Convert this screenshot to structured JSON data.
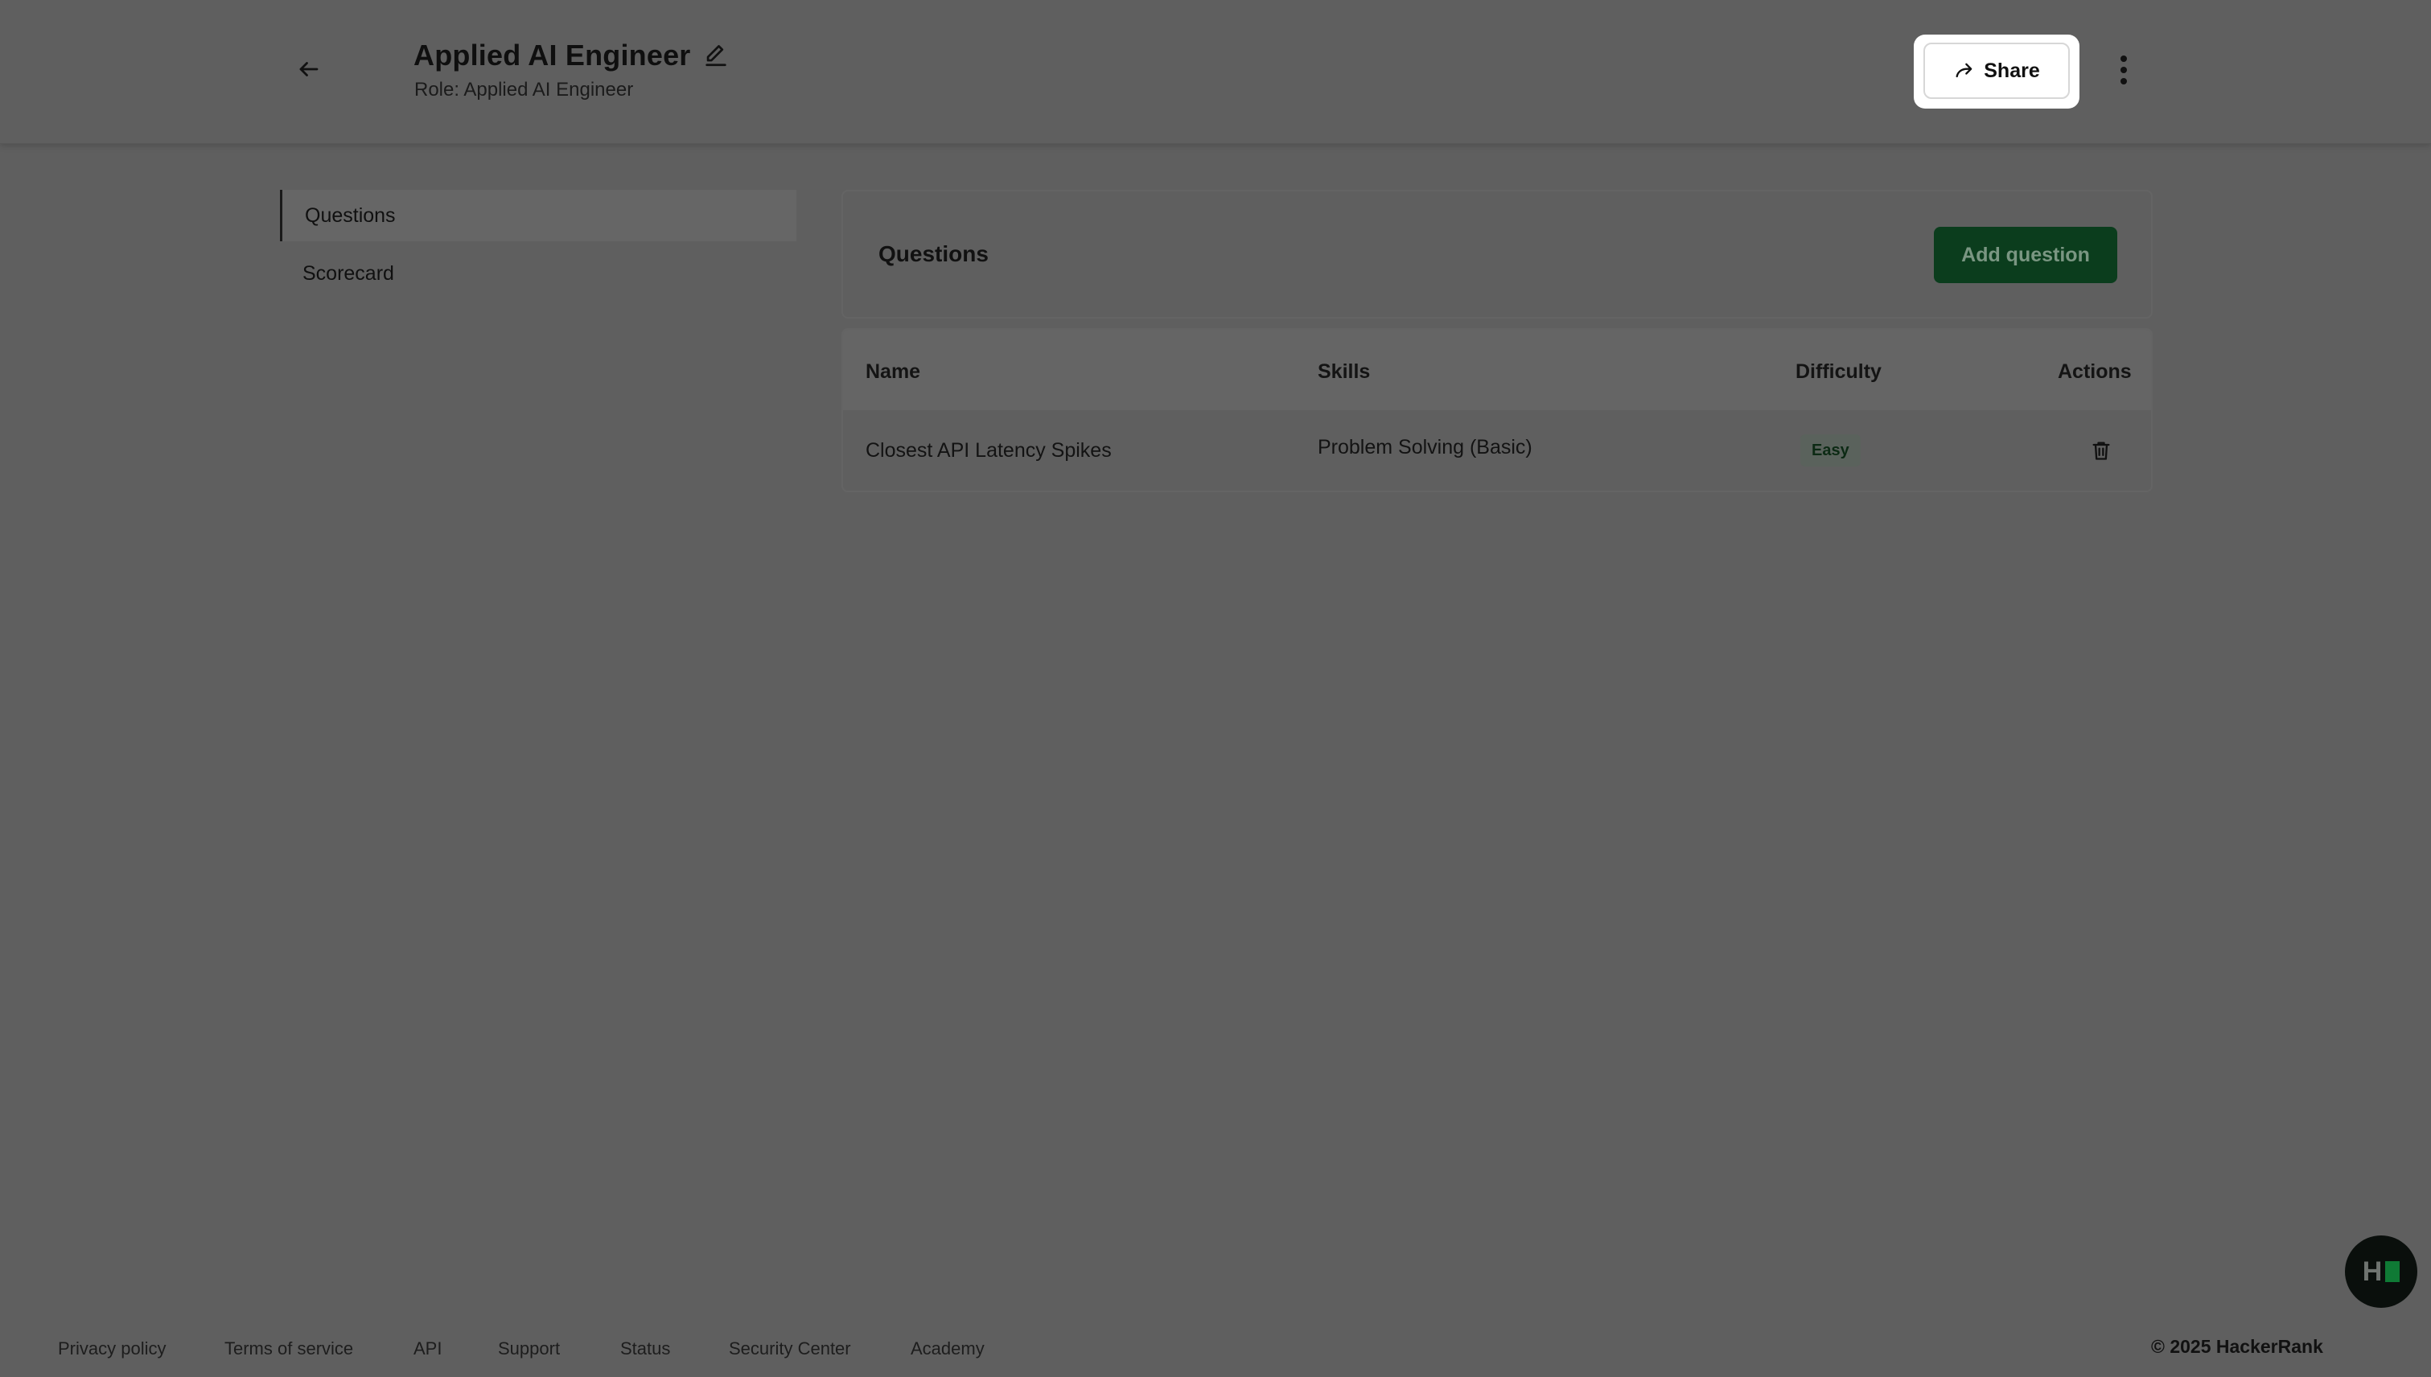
{
  "header": {
    "title": "Applied AI Engineer",
    "subtitle": "Role: Applied AI Engineer",
    "share_label": "Share",
    "icons": [
      "arrow-left-icon",
      "pencil-icon",
      "share-arrow-icon",
      "kebab-menu-icon"
    ]
  },
  "sidebar": {
    "items": [
      {
        "label": "Questions",
        "active": true
      },
      {
        "label": "Scorecard",
        "active": false
      }
    ]
  },
  "questions": {
    "title": "Questions",
    "add_label": "Add question",
    "add_button_color": "#0b3d1d",
    "columns": [
      "Name",
      "Skills",
      "Difficulty",
      "Actions"
    ],
    "rows": [
      {
        "name": "Closest API Latency Spikes",
        "skills": "Problem Solving (Basic)",
        "difficulty": "Easy"
      }
    ]
  },
  "footer": {
    "links": [
      "Privacy policy",
      "Terms of service",
      "API",
      "Support",
      "Status",
      "Security Center",
      "Academy"
    ],
    "copyright": "© 2025 HackerRank"
  },
  "fab": {
    "letter": "H",
    "accent": "#0f7a35"
  }
}
